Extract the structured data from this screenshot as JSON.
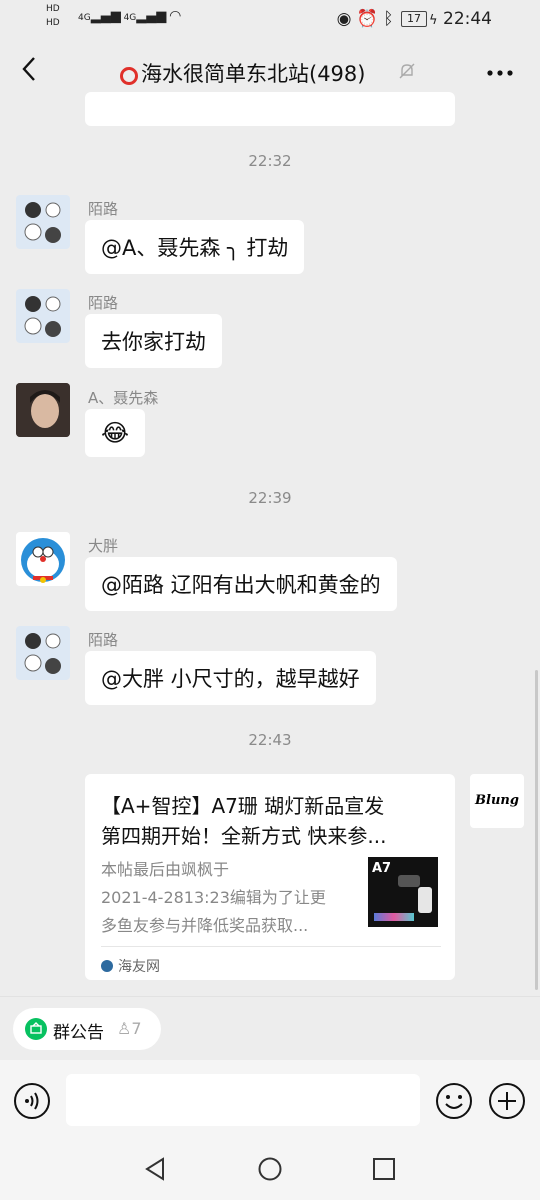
{
  "status": {
    "left_labels": [
      "HD",
      "HD"
    ],
    "signal": "4G",
    "battery": "17",
    "time": "22:44"
  },
  "header": {
    "back_icon": "chevron-left-icon",
    "title": "海水很简单东北站(498)",
    "mute_icon": "bell-off-icon",
    "more_icon": "more-dots-icon"
  },
  "messages": [
    {
      "type": "time",
      "text": "22:32"
    },
    {
      "type": "msg",
      "sender": "陌路",
      "text": "@A、聂先森 ╮ 打劫"
    },
    {
      "type": "msg",
      "sender": "陌路",
      "text": "去你家打劫"
    },
    {
      "type": "msg",
      "sender": "A、聂先森",
      "text": "😂"
    },
    {
      "type": "time",
      "text": "22:39"
    },
    {
      "type": "msg",
      "sender": "大胖",
      "text": "@陌路  辽阳有出大帆和黄金的"
    },
    {
      "type": "msg",
      "sender": "陌路",
      "text": "@大胖  小尺寸的，越早越好"
    },
    {
      "type": "time",
      "text": "22:43"
    }
  ],
  "card": {
    "title_line1": "【A+智控】A7珊 瑚灯新品宣发",
    "title_line2": "第四期开始！全新方式  快来参...",
    "desc_line1": "本帖最后由飒枫于",
    "desc_line2": "2021-4-2813:23编辑为了让更",
    "desc_line3": "多鱼友参与并降低奖品获取...",
    "thumb_label": "A7",
    "source": "海友网",
    "sender_avatar_text": "Blung"
  },
  "notice": {
    "label": "群公告",
    "count": "7"
  },
  "input": {
    "placeholder": ""
  },
  "colors": {
    "background": "#ededed",
    "bubble": "#ffffff",
    "accent_green": "#07c160",
    "red": "#e0302a"
  }
}
